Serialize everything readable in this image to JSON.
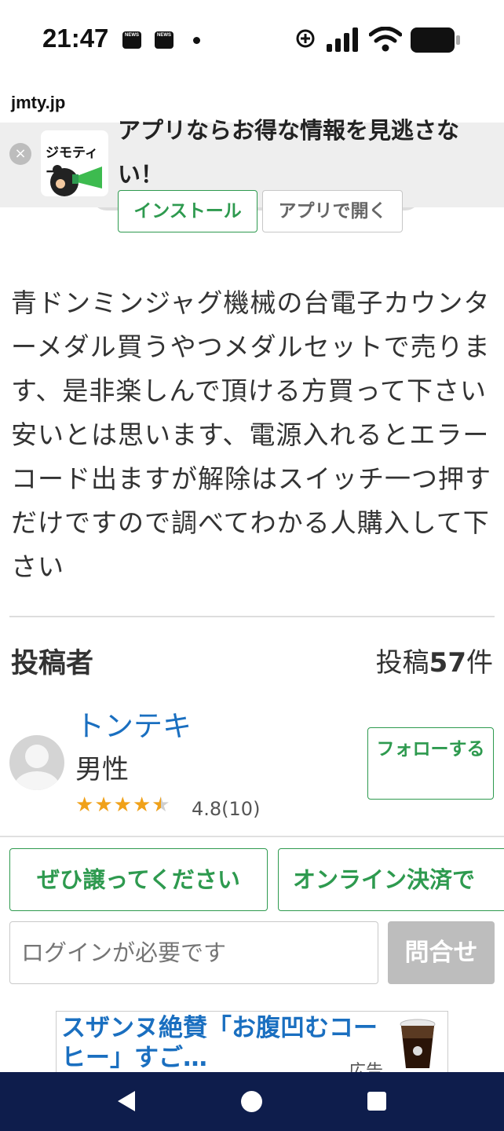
{
  "status_bar": {
    "time": "21:47",
    "news_label": "NEWS"
  },
  "browser": {
    "url": "jmty.jp"
  },
  "app_banner": {
    "logo_text": "ジモティー",
    "message": "アプリならお得な情報を見逃さない！",
    "install_label": "インストール",
    "open_label": "アプリで開く"
  },
  "listing": {
    "description": "青ドンミンジャグ機械の台電子カウンターメダル買うやつメダルセットで売ります、是非楽しんで頂ける方買って下さい安いとは思います、電源入れるとエラーコード出ますが解除はスイッチ一つ押すだけですので調べてわかる人購入して下さい"
  },
  "poster": {
    "heading": "投稿者",
    "post_count_prefix": "投稿",
    "post_count": "57",
    "post_count_suffix": "件",
    "name": "トンテキ",
    "gender": "男性",
    "rating": "4.8",
    "rating_count": "(10)",
    "rating_value": 4.8,
    "follow_label": "フォローする"
  },
  "actions": {
    "please_label": "ぜひ譲ってください",
    "online_label": "オンライン決済で",
    "login_placeholder": "ログインが必要です",
    "inquire_label": "問合せ"
  },
  "ad": {
    "text": "スザンヌ絶賛「お腹凹むコーヒー」すご…",
    "tag": "広告"
  },
  "colors": {
    "accent_green": "#2e9a4f",
    "link_blue": "#1a6fc0",
    "star_orange": "#f0a119",
    "nav_bar": "#0e1d4c"
  }
}
